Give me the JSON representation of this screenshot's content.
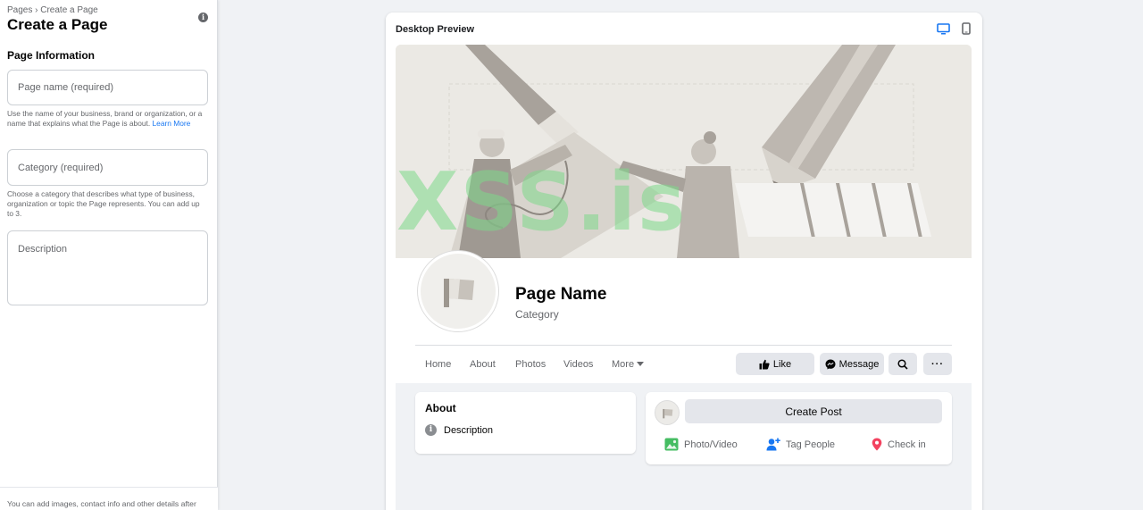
{
  "left": {
    "breadcrumb": "Pages › Create a Page",
    "title": "Create a Page",
    "section_title": "Page Information",
    "name_placeholder": "Page name (required)",
    "name_help": "Use the name of your business, brand or organization, or a name that explains what the Page is about.",
    "name_help_link": "Learn More",
    "category_placeholder": "Category (required)",
    "category_help": "Choose a category that describes what type of business, organization or topic the Page represents. You can add up to 3.",
    "description_placeholder": "Description",
    "footer_text": "You can add images, contact info and other details after"
  },
  "preview": {
    "title": "Desktop Preview",
    "page_name": "Page Name",
    "category": "Category",
    "nav": [
      "Home",
      "About",
      "Photos",
      "Videos",
      "More"
    ],
    "actions": {
      "like": "Like",
      "message": "Message",
      "more": "···"
    },
    "about": {
      "title": "About",
      "description": "Description"
    },
    "post": {
      "create": "Create Post",
      "photo_video": "Photo/Video",
      "tag_people": "Tag People",
      "check_in": "Check in"
    },
    "watermark": "XSS.is"
  },
  "colors": {
    "accent": "#1877f2",
    "photo_green": "#45bd62",
    "checkin_red": "#f3425f",
    "watermark": "#7ed98a"
  }
}
